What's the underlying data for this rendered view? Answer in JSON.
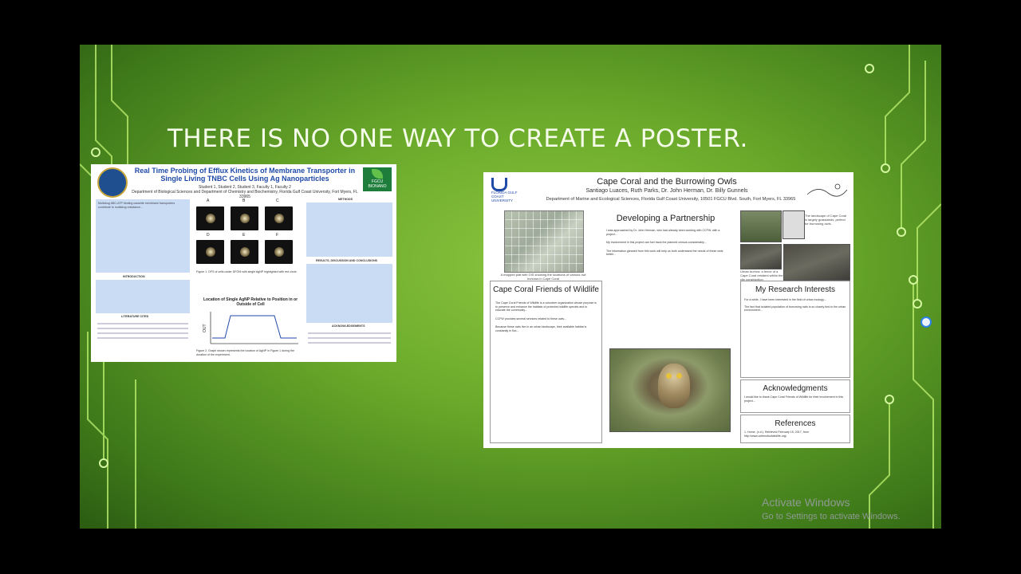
{
  "slide": {
    "title": "THERE IS NO ONE WAY TO CREATE A POSTER."
  },
  "poster1": {
    "title": "Real Time Probing of Efflux Kinetics of Membrane Transporter in Single Living TNBC Cells Using Ag Nanoparticles",
    "authors": "Student 1, Student 2, Student 3, Faculty 1, Faculty 2",
    "affiliation": "Department of Biological Sciences and Department of Chemistry and Biochemistry, Florida Gulf Coast University, Fort Myers, FL 33965",
    "logo_label": "FGCU BIONANO",
    "sections": {
      "introduction": "INTRODUCTION",
      "literature": "LITERATURE CITED",
      "methods": "METHODS",
      "results": "RESULTS, DISCUSSION AND CONCLUSIONS",
      "acknowledgements": "ACKNOWLEDGEMENTS"
    },
    "panel_labels": [
      "A",
      "B",
      "C",
      "D",
      "E",
      "F"
    ],
    "figure1_caption": "Figure 1. DFS of cells under DFOM with single AgNP highlighted with red circle.",
    "chart_title": "Location of Single AgNP Relative to Position in or Outside of Cell",
    "chart_ylabel": "OUT",
    "figure2_caption": "Figure 2. Graph shown represents the location of AgNP in Figure 1 during the duration of the experiment."
  },
  "poster2": {
    "title": "Cape Coral and the Burrowing Owls",
    "authors": "Santiago Luaces, Ruth Parks, Dr. John Herman, Dr. Billy Gunnels",
    "department": "Department of Marine and Ecological Sciences, Florida Gulf Coast University, 10501 FGCU Blvd. South, Fort Myers, FL 33965",
    "logo_text": "FLORIDA GULF COAST UNIVERSITY",
    "sections": {
      "friends": "Cape Coral Friends of Wildlife",
      "partnership": "Developing a Partnership",
      "research": "My Research Interests",
      "acknowledgments": "Acknowledgments",
      "references": "References"
    },
    "map_caption": "A mapped plat with GIS showing the locations of various owl burrows in Cape Coral",
    "photo_caption": "Urban burrow: a fence of a Cape Coral resident within the city construction",
    "side_caption": "The landscape of Cape Coral is largely grasslands, perfect for burrowing owls.",
    "reference_1": "1. Home. (n.d.). Retrieved February 15, 2017, from http://www.ccfriendsofwildlife.org/"
  },
  "overlay": {
    "activate_title": "Activate Windows",
    "activate_sub": "Go to Settings to activate Windows."
  },
  "colors": {
    "slide_green": "#6aa92a",
    "title_blue": "#1f4aa8",
    "cursor_blue": "#2c80e0"
  }
}
